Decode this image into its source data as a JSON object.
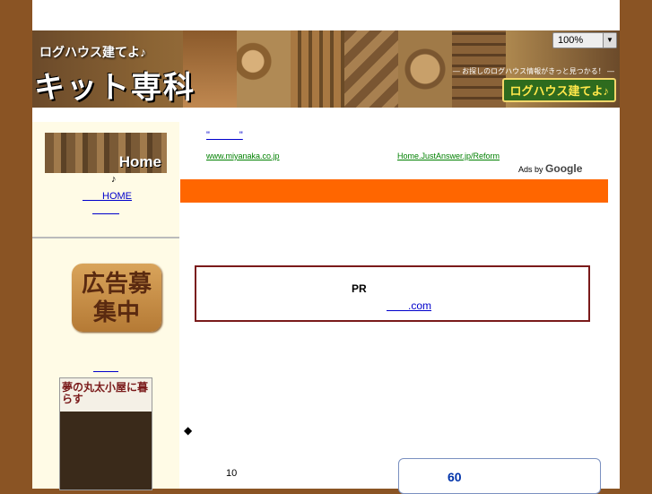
{
  "zoom": {
    "value": "100%"
  },
  "banner": {
    "subtitle": "ログハウス建てよ♪",
    "title": "キット専科",
    "tagline": "― お探しのログハウス情報がきっと見つかる！ ―",
    "sign": "ログハウス建てよ♪"
  },
  "sidebar": {
    "home_image_text": "Home",
    "note": "♪",
    "home_link": "HOME",
    "ad_badge": "広告募集中",
    "book_title": "夢の丸太小屋に暮らす"
  },
  "ads": {
    "ad1_title": "\"　　　\"",
    "ad1_url": "www.miyanaka.co.jp",
    "ad2_title": "",
    "ad2_url": "Home.JustAnswer.jp/Reform",
    "ads_by": "Ads by",
    "google": "Google"
  },
  "pr_box": {
    "label": "PR",
    "link": ".com"
  },
  "content": {
    "diamond": "◆",
    "ten": "10",
    "sixty": "60"
  },
  "colors": {
    "background": "#8a5424",
    "orange_bar": "#ff6600",
    "pr_border": "#7a1a1a",
    "sidebar_bg": "#fffbe6"
  }
}
